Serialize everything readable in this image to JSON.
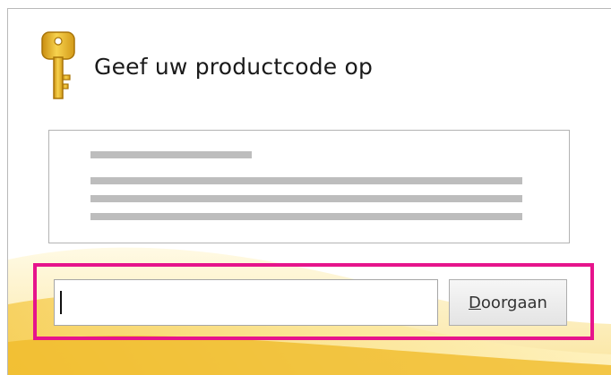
{
  "dialog": {
    "title": "Geef uw productcode op",
    "icon": "key-icon"
  },
  "product_key": {
    "value": "",
    "placeholder": ""
  },
  "continue_button": {
    "mnemonic": "D",
    "label_rest": "oorgaan"
  },
  "colors": {
    "highlight": "#e6148c",
    "key_gold": "#e8b623",
    "swoosh": "#f7d565"
  }
}
